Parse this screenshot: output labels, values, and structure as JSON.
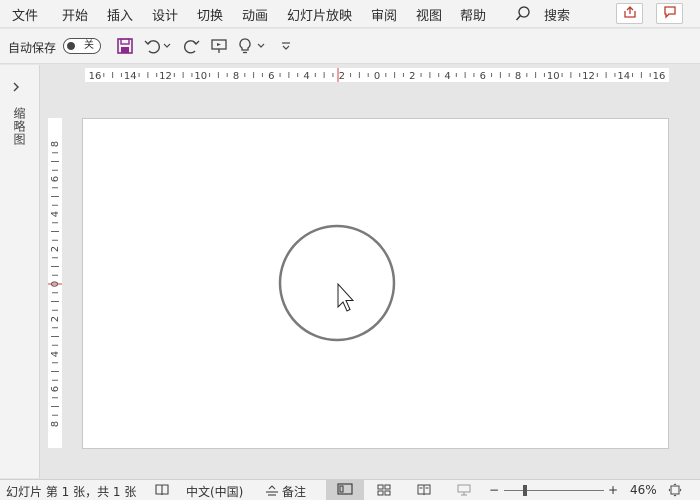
{
  "menu": {
    "items": [
      "文件",
      "开始",
      "插入",
      "设计",
      "切换",
      "动画",
      "幻灯片放映",
      "审阅",
      "视图",
      "帮助"
    ],
    "search_label": "搜索"
  },
  "qat": {
    "autosave_label": "自动保存",
    "autosave_state": "关"
  },
  "left_pane": {
    "label": "缩略图"
  },
  "ruler": {
    "horizontal_labels": [
      "16",
      "14",
      "12",
      "10",
      "8",
      "6",
      "4",
      "2",
      "0",
      "2",
      "4",
      "6",
      "8",
      "10",
      "12",
      "14",
      "16"
    ],
    "vertical_labels": [
      "8",
      "6",
      "4",
      "2",
      "0",
      "2",
      "4",
      "6",
      "8"
    ]
  },
  "statusbar": {
    "slide_info": "幻灯片 第 1 张，共 1 张",
    "language": "中文(中国)",
    "notes_label": "备注",
    "zoom_minus": "−",
    "zoom_plus": "+",
    "zoom_level": "46%"
  },
  "colors": {
    "accent_save": "#8a2a8a",
    "share_icon": "#c0392b",
    "chrome_bg": "#f3f3f3",
    "workspace_bg": "#e6e6e6"
  }
}
